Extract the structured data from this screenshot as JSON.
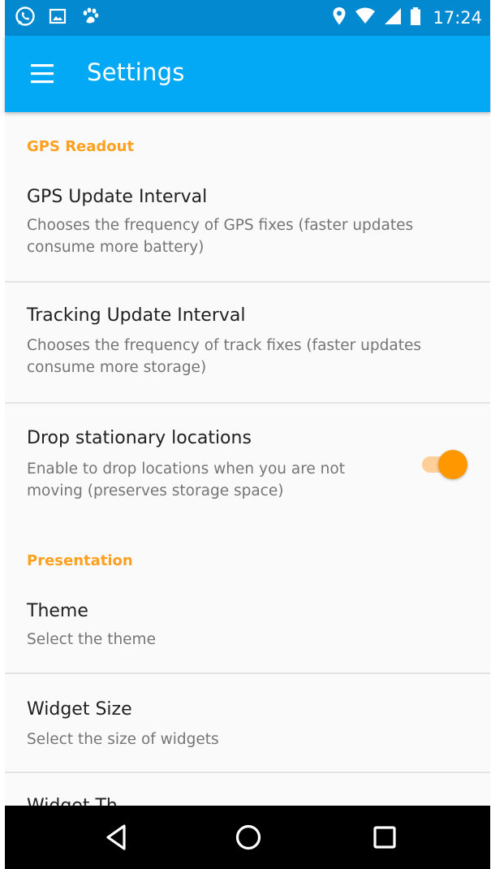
{
  "status_bar": {
    "time": "17:24",
    "left_icons": [
      "whatsapp-icon",
      "image-notification-icon",
      "paw-notification-icon"
    ],
    "right_icons": [
      "location-icon",
      "wifi-icon",
      "cell-signal-icon",
      "battery-icon"
    ]
  },
  "app_bar": {
    "title": "Settings",
    "menu_icon": "hamburger-menu-icon"
  },
  "sections": {
    "gps_readout": {
      "header": "GPS Readout",
      "gps_update_interval": {
        "title": "GPS Update Interval",
        "summary": "Chooses the frequency of GPS fixes (faster updates consume more battery)"
      },
      "tracking_update_interval": {
        "title": "Tracking Update Interval",
        "summary": "Chooses the frequency of track fixes (faster updates consume more storage)"
      },
      "drop_stationary_locations": {
        "title": "Drop stationary locations",
        "summary": "Enable to drop locations when you are not moving (preserves storage space)",
        "enabled": true
      }
    },
    "presentation": {
      "header": "Presentation",
      "theme": {
        "title": "Theme",
        "summary": "Select the theme"
      },
      "widget_size": {
        "title": "Widget Size",
        "summary": "Select the size of widgets"
      },
      "widget_theme_partial": {
        "title": "Widget Th"
      }
    }
  },
  "nav_bar": {
    "back_icon": "back-triangle-icon",
    "home_icon": "home-circle-icon",
    "recents_icon": "recents-square-icon"
  },
  "colors": {
    "status_bar": "#0289cf",
    "app_bar": "#03a9f4",
    "accent": "#ff9800",
    "section_header": "#ffa01f",
    "title_text": "#212121",
    "summary_text": "#757575"
  }
}
